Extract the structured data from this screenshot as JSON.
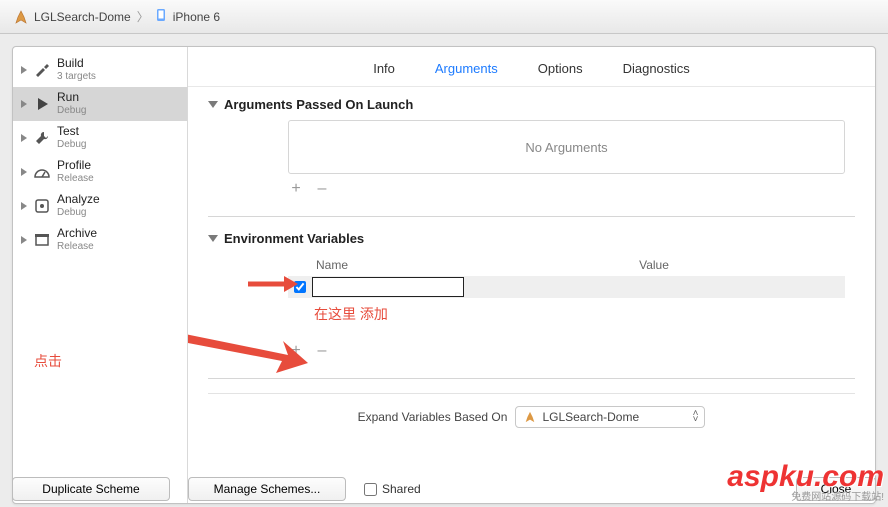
{
  "breadcrumb": {
    "project": "LGLSearch-Dome",
    "device": "iPhone 6"
  },
  "sidebar": {
    "items": [
      {
        "title": "Build",
        "sub": "3 targets",
        "icon": "hammer"
      },
      {
        "title": "Run",
        "sub": "Debug",
        "icon": "play",
        "selected": true
      },
      {
        "title": "Test",
        "sub": "Debug",
        "icon": "wrench"
      },
      {
        "title": "Profile",
        "sub": "Release",
        "icon": "gauge"
      },
      {
        "title": "Analyze",
        "sub": "Debug",
        "icon": "analyze"
      },
      {
        "title": "Archive",
        "sub": "Release",
        "icon": "archive"
      }
    ]
  },
  "tabs": [
    {
      "label": "Info"
    },
    {
      "label": "Arguments",
      "active": true
    },
    {
      "label": "Options"
    },
    {
      "label": "Diagnostics"
    }
  ],
  "sections": {
    "args": {
      "title": "Arguments Passed On Launch",
      "placeholder": "No Arguments"
    },
    "env": {
      "title": "Environment Variables",
      "columns": {
        "name": "Name",
        "value": "Value"
      },
      "row": {
        "checked": true,
        "name": "",
        "value": ""
      }
    }
  },
  "annotations": {
    "click_hint": "点击",
    "add_hint": "在这里 添加"
  },
  "expand": {
    "label": "Expand Variables Based On",
    "value": "LGLSearch-Dome"
  },
  "buttons": {
    "duplicate": "Duplicate Scheme",
    "manage": "Manage Schemes...",
    "shared": "Shared",
    "close": "Close",
    "plus": "+",
    "minus": "–"
  },
  "watermark": {
    "main": "aspku.com",
    "sub": "免费网站源码下载站!"
  }
}
